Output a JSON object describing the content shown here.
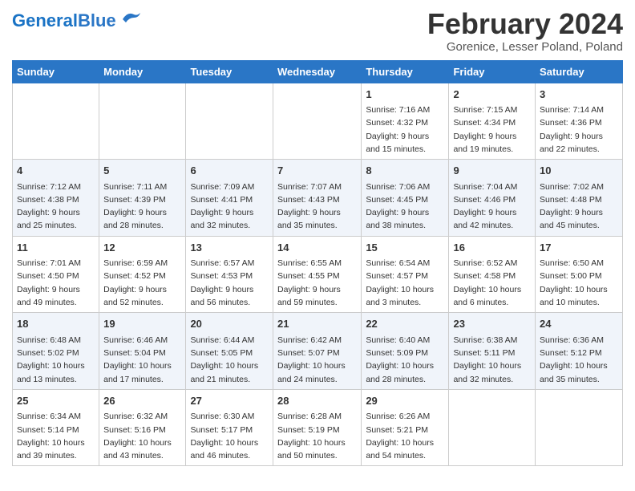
{
  "header": {
    "logo_general": "General",
    "logo_blue": "Blue",
    "month_title": "February 2024",
    "location": "Gorenice, Lesser Poland, Poland"
  },
  "days_of_week": [
    "Sunday",
    "Monday",
    "Tuesday",
    "Wednesday",
    "Thursday",
    "Friday",
    "Saturday"
  ],
  "weeks": [
    [
      {
        "day": "",
        "info": ""
      },
      {
        "day": "",
        "info": ""
      },
      {
        "day": "",
        "info": ""
      },
      {
        "day": "",
        "info": ""
      },
      {
        "day": "1",
        "info": "Sunrise: 7:16 AM\nSunset: 4:32 PM\nDaylight: 9 hours\nand 15 minutes."
      },
      {
        "day": "2",
        "info": "Sunrise: 7:15 AM\nSunset: 4:34 PM\nDaylight: 9 hours\nand 19 minutes."
      },
      {
        "day": "3",
        "info": "Sunrise: 7:14 AM\nSunset: 4:36 PM\nDaylight: 9 hours\nand 22 minutes."
      }
    ],
    [
      {
        "day": "4",
        "info": "Sunrise: 7:12 AM\nSunset: 4:38 PM\nDaylight: 9 hours\nand 25 minutes."
      },
      {
        "day": "5",
        "info": "Sunrise: 7:11 AM\nSunset: 4:39 PM\nDaylight: 9 hours\nand 28 minutes."
      },
      {
        "day": "6",
        "info": "Sunrise: 7:09 AM\nSunset: 4:41 PM\nDaylight: 9 hours\nand 32 minutes."
      },
      {
        "day": "7",
        "info": "Sunrise: 7:07 AM\nSunset: 4:43 PM\nDaylight: 9 hours\nand 35 minutes."
      },
      {
        "day": "8",
        "info": "Sunrise: 7:06 AM\nSunset: 4:45 PM\nDaylight: 9 hours\nand 38 minutes."
      },
      {
        "day": "9",
        "info": "Sunrise: 7:04 AM\nSunset: 4:46 PM\nDaylight: 9 hours\nand 42 minutes."
      },
      {
        "day": "10",
        "info": "Sunrise: 7:02 AM\nSunset: 4:48 PM\nDaylight: 9 hours\nand 45 minutes."
      }
    ],
    [
      {
        "day": "11",
        "info": "Sunrise: 7:01 AM\nSunset: 4:50 PM\nDaylight: 9 hours\nand 49 minutes."
      },
      {
        "day": "12",
        "info": "Sunrise: 6:59 AM\nSunset: 4:52 PM\nDaylight: 9 hours\nand 52 minutes."
      },
      {
        "day": "13",
        "info": "Sunrise: 6:57 AM\nSunset: 4:53 PM\nDaylight: 9 hours\nand 56 minutes."
      },
      {
        "day": "14",
        "info": "Sunrise: 6:55 AM\nSunset: 4:55 PM\nDaylight: 9 hours\nand 59 minutes."
      },
      {
        "day": "15",
        "info": "Sunrise: 6:54 AM\nSunset: 4:57 PM\nDaylight: 10 hours\nand 3 minutes."
      },
      {
        "day": "16",
        "info": "Sunrise: 6:52 AM\nSunset: 4:58 PM\nDaylight: 10 hours\nand 6 minutes."
      },
      {
        "day": "17",
        "info": "Sunrise: 6:50 AM\nSunset: 5:00 PM\nDaylight: 10 hours\nand 10 minutes."
      }
    ],
    [
      {
        "day": "18",
        "info": "Sunrise: 6:48 AM\nSunset: 5:02 PM\nDaylight: 10 hours\nand 13 minutes."
      },
      {
        "day": "19",
        "info": "Sunrise: 6:46 AM\nSunset: 5:04 PM\nDaylight: 10 hours\nand 17 minutes."
      },
      {
        "day": "20",
        "info": "Sunrise: 6:44 AM\nSunset: 5:05 PM\nDaylight: 10 hours\nand 21 minutes."
      },
      {
        "day": "21",
        "info": "Sunrise: 6:42 AM\nSunset: 5:07 PM\nDaylight: 10 hours\nand 24 minutes."
      },
      {
        "day": "22",
        "info": "Sunrise: 6:40 AM\nSunset: 5:09 PM\nDaylight: 10 hours\nand 28 minutes."
      },
      {
        "day": "23",
        "info": "Sunrise: 6:38 AM\nSunset: 5:11 PM\nDaylight: 10 hours\nand 32 minutes."
      },
      {
        "day": "24",
        "info": "Sunrise: 6:36 AM\nSunset: 5:12 PM\nDaylight: 10 hours\nand 35 minutes."
      }
    ],
    [
      {
        "day": "25",
        "info": "Sunrise: 6:34 AM\nSunset: 5:14 PM\nDaylight: 10 hours\nand 39 minutes."
      },
      {
        "day": "26",
        "info": "Sunrise: 6:32 AM\nSunset: 5:16 PM\nDaylight: 10 hours\nand 43 minutes."
      },
      {
        "day": "27",
        "info": "Sunrise: 6:30 AM\nSunset: 5:17 PM\nDaylight: 10 hours\nand 46 minutes."
      },
      {
        "day": "28",
        "info": "Sunrise: 6:28 AM\nSunset: 5:19 PM\nDaylight: 10 hours\nand 50 minutes."
      },
      {
        "day": "29",
        "info": "Sunrise: 6:26 AM\nSunset: 5:21 PM\nDaylight: 10 hours\nand 54 minutes."
      },
      {
        "day": "",
        "info": ""
      },
      {
        "day": "",
        "info": ""
      }
    ]
  ]
}
